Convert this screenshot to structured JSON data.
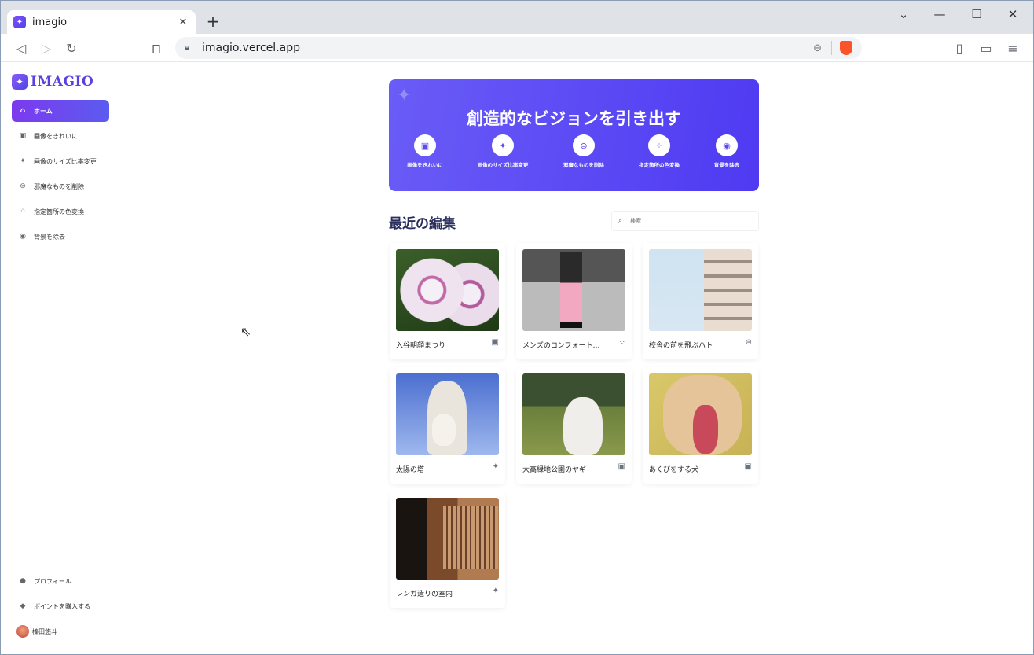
{
  "browser": {
    "tab_title": "imagio",
    "url": "imagio.vercel.app",
    "new_tab_label": "+",
    "window_controls": [
      "chevron-down-icon",
      "minimize-icon",
      "maximize-icon",
      "close-icon"
    ]
  },
  "app": {
    "logo_text": "IMAGIO",
    "brand_color": "#5b3fe0"
  },
  "sidebar": {
    "items": [
      {
        "label": "ホーム",
        "icon": "home-icon",
        "active": true
      },
      {
        "label": "画像をきれいに",
        "icon": "image-icon",
        "active": false
      },
      {
        "label": "画像のサイズ比率変更",
        "icon": "sparkle-icon",
        "active": false
      },
      {
        "label": "邪魔なものを削除",
        "icon": "erase-icon",
        "active": false
      },
      {
        "label": "指定箇所の色変換",
        "icon": "palette-icon",
        "active": false
      },
      {
        "label": "背景を除去",
        "icon": "camera-icon",
        "active": false
      }
    ],
    "bottom_items": [
      {
        "label": "プロフィール",
        "icon": "user-icon"
      },
      {
        "label": "ポイントを購入する",
        "icon": "bag-icon"
      },
      {
        "label": "榛田悠斗",
        "icon": "avatar"
      }
    ]
  },
  "hero": {
    "title": "創造的なビジョンを引き出す",
    "actions": [
      {
        "label": "画像をきれいに",
        "icon": "image-icon"
      },
      {
        "label": "画像のサイズ比率変更",
        "icon": "sparkle-icon"
      },
      {
        "label": "邪魔なものを削除",
        "icon": "erase-icon"
      },
      {
        "label": "指定箇所の色変換",
        "icon": "palette-icon"
      },
      {
        "label": "背景を除去",
        "icon": "camera-icon"
      }
    ]
  },
  "recent": {
    "title": "最近の編集",
    "search_placeholder": "検索",
    "items": [
      {
        "name": "入谷朝顔まつり",
        "icon": "image-icon"
      },
      {
        "name": "メンズのコンフォート…",
        "icon": "palette-icon"
      },
      {
        "name": "校舎の前を飛ぶハト",
        "icon": "erase-icon"
      },
      {
        "name": "太陽の塔",
        "icon": "sparkle-icon"
      },
      {
        "name": "大高緑地公園のヤギ",
        "icon": "image-icon"
      },
      {
        "name": "あくびをする犬",
        "icon": "image-icon"
      },
      {
        "name": "レンガ造りの室内",
        "icon": "sparkle-icon"
      }
    ]
  }
}
